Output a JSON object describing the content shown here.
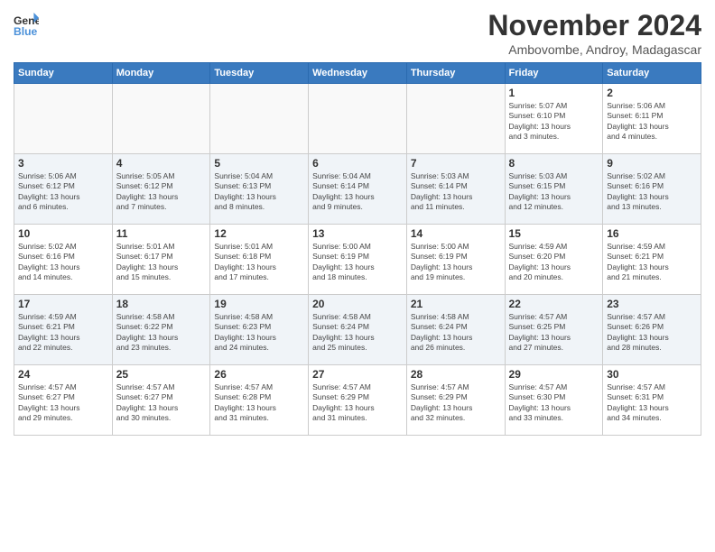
{
  "logo": {
    "text_general": "General",
    "text_blue": "Blue"
  },
  "title": "November 2024",
  "subtitle": "Ambovombe, Androy, Madagascar",
  "days_of_week": [
    "Sunday",
    "Monday",
    "Tuesday",
    "Wednesday",
    "Thursday",
    "Friday",
    "Saturday"
  ],
  "weeks": [
    {
      "days": [
        {
          "num": "",
          "info": "",
          "empty": true
        },
        {
          "num": "",
          "info": "",
          "empty": true
        },
        {
          "num": "",
          "info": "",
          "empty": true
        },
        {
          "num": "",
          "info": "",
          "empty": true
        },
        {
          "num": "",
          "info": "",
          "empty": true
        },
        {
          "num": "1",
          "info": "Sunrise: 5:07 AM\nSunset: 6:10 PM\nDaylight: 13 hours\nand 3 minutes."
        },
        {
          "num": "2",
          "info": "Sunrise: 5:06 AM\nSunset: 6:11 PM\nDaylight: 13 hours\nand 4 minutes."
        }
      ],
      "shaded": false
    },
    {
      "days": [
        {
          "num": "3",
          "info": "Sunrise: 5:06 AM\nSunset: 6:12 PM\nDaylight: 13 hours\nand 6 minutes."
        },
        {
          "num": "4",
          "info": "Sunrise: 5:05 AM\nSunset: 6:12 PM\nDaylight: 13 hours\nand 7 minutes."
        },
        {
          "num": "5",
          "info": "Sunrise: 5:04 AM\nSunset: 6:13 PM\nDaylight: 13 hours\nand 8 minutes."
        },
        {
          "num": "6",
          "info": "Sunrise: 5:04 AM\nSunset: 6:14 PM\nDaylight: 13 hours\nand 9 minutes."
        },
        {
          "num": "7",
          "info": "Sunrise: 5:03 AM\nSunset: 6:14 PM\nDaylight: 13 hours\nand 11 minutes."
        },
        {
          "num": "8",
          "info": "Sunrise: 5:03 AM\nSunset: 6:15 PM\nDaylight: 13 hours\nand 12 minutes."
        },
        {
          "num": "9",
          "info": "Sunrise: 5:02 AM\nSunset: 6:16 PM\nDaylight: 13 hours\nand 13 minutes."
        }
      ],
      "shaded": true
    },
    {
      "days": [
        {
          "num": "10",
          "info": "Sunrise: 5:02 AM\nSunset: 6:16 PM\nDaylight: 13 hours\nand 14 minutes."
        },
        {
          "num": "11",
          "info": "Sunrise: 5:01 AM\nSunset: 6:17 PM\nDaylight: 13 hours\nand 15 minutes."
        },
        {
          "num": "12",
          "info": "Sunrise: 5:01 AM\nSunset: 6:18 PM\nDaylight: 13 hours\nand 17 minutes."
        },
        {
          "num": "13",
          "info": "Sunrise: 5:00 AM\nSunset: 6:19 PM\nDaylight: 13 hours\nand 18 minutes."
        },
        {
          "num": "14",
          "info": "Sunrise: 5:00 AM\nSunset: 6:19 PM\nDaylight: 13 hours\nand 19 minutes."
        },
        {
          "num": "15",
          "info": "Sunrise: 4:59 AM\nSunset: 6:20 PM\nDaylight: 13 hours\nand 20 minutes."
        },
        {
          "num": "16",
          "info": "Sunrise: 4:59 AM\nSunset: 6:21 PM\nDaylight: 13 hours\nand 21 minutes."
        }
      ],
      "shaded": false
    },
    {
      "days": [
        {
          "num": "17",
          "info": "Sunrise: 4:59 AM\nSunset: 6:21 PM\nDaylight: 13 hours\nand 22 minutes."
        },
        {
          "num": "18",
          "info": "Sunrise: 4:58 AM\nSunset: 6:22 PM\nDaylight: 13 hours\nand 23 minutes."
        },
        {
          "num": "19",
          "info": "Sunrise: 4:58 AM\nSunset: 6:23 PM\nDaylight: 13 hours\nand 24 minutes."
        },
        {
          "num": "20",
          "info": "Sunrise: 4:58 AM\nSunset: 6:24 PM\nDaylight: 13 hours\nand 25 minutes."
        },
        {
          "num": "21",
          "info": "Sunrise: 4:58 AM\nSunset: 6:24 PM\nDaylight: 13 hours\nand 26 minutes."
        },
        {
          "num": "22",
          "info": "Sunrise: 4:57 AM\nSunset: 6:25 PM\nDaylight: 13 hours\nand 27 minutes."
        },
        {
          "num": "23",
          "info": "Sunrise: 4:57 AM\nSunset: 6:26 PM\nDaylight: 13 hours\nand 28 minutes."
        }
      ],
      "shaded": true
    },
    {
      "days": [
        {
          "num": "24",
          "info": "Sunrise: 4:57 AM\nSunset: 6:27 PM\nDaylight: 13 hours\nand 29 minutes."
        },
        {
          "num": "25",
          "info": "Sunrise: 4:57 AM\nSunset: 6:27 PM\nDaylight: 13 hours\nand 30 minutes."
        },
        {
          "num": "26",
          "info": "Sunrise: 4:57 AM\nSunset: 6:28 PM\nDaylight: 13 hours\nand 31 minutes."
        },
        {
          "num": "27",
          "info": "Sunrise: 4:57 AM\nSunset: 6:29 PM\nDaylight: 13 hours\nand 31 minutes."
        },
        {
          "num": "28",
          "info": "Sunrise: 4:57 AM\nSunset: 6:29 PM\nDaylight: 13 hours\nand 32 minutes."
        },
        {
          "num": "29",
          "info": "Sunrise: 4:57 AM\nSunset: 6:30 PM\nDaylight: 13 hours\nand 33 minutes."
        },
        {
          "num": "30",
          "info": "Sunrise: 4:57 AM\nSunset: 6:31 PM\nDaylight: 13 hours\nand 34 minutes."
        }
      ],
      "shaded": false
    }
  ]
}
